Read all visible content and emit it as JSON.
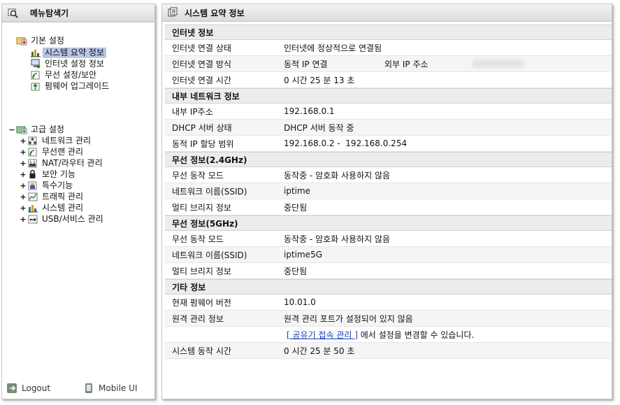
{
  "left": {
    "title": "메뉴탐색기",
    "groups": {
      "basic": {
        "label": "기본 설정",
        "items": [
          "시스템 요약 정보",
          "인터넷 설정 정보",
          "무선 설정/보안",
          "펌웨어 업그레이드"
        ]
      },
      "advanced": {
        "toggle": "−",
        "label": "고급 설정",
        "items": [
          "네트워크 관리",
          "무선랜 관리",
          "NAT/라우터 관리",
          "보안 기능",
          "특수기능",
          "트래픽 관리",
          "시스템 관리",
          "USB/서비스 관리"
        ],
        "item_toggle": "+"
      }
    },
    "bottom": {
      "logout": "Logout",
      "mobile": "Mobile UI"
    }
  },
  "right": {
    "title": "시스템 요약 정보",
    "internet": {
      "title": "인터넷 정보",
      "status_k": "인터넷 연결 상태",
      "status_v": "인터넷에 정상적으로 연결됨",
      "method_k": "인터넷 연결 방식",
      "method_v": "동적 IP 연결",
      "external_ip_k": "외부 IP 주소",
      "time_k": "인터넷 연결 시간",
      "time_v": "0 시간 25 분 13 초"
    },
    "lan": {
      "title": "내부 네트워크 정보",
      "ip_k": "내부 IP주소",
      "ip_v": "192.168.0.1",
      "dhcp_k": "DHCP 서버 상태",
      "dhcp_v": "DHCP 서버 동작 중",
      "range_k": "동적 IP 할당 범위",
      "range_v": "192.168.0.2 -  192.168.0.254"
    },
    "w24": {
      "title": "무선 정보(2.4GHz)",
      "mode_k": "무선 동작 모드",
      "mode_v": "동작중 - 암호화 사용하지 않음",
      "ssid_k": "네트워크 이름(SSID)",
      "ssid_v": "iptime",
      "bridge_k": "멀티 브리지 정보",
      "bridge_v": "중단됨"
    },
    "w5": {
      "title": "무선 정보(5GHz)",
      "mode_k": "무선 동작 모드",
      "mode_v": "동작중 - 암호화 사용하지 않음",
      "ssid_k": "네트워크 이름(SSID)",
      "ssid_v": "iptime5G",
      "bridge_k": "멀티 브리지 정보",
      "bridge_v": "중단됨"
    },
    "etc": {
      "title": "기타 정보",
      "fw_k": "현재 펌웨어 버전",
      "fw_v": "10.01.0",
      "remote_k": "원격 관리 정보",
      "remote_v": "원격 관리 포트가 설정되어 있지 않음",
      "remote_link": "[ 공유기 접속 관리 ]",
      "remote_link_tail": "에서 설정을 변경할 수 있습니다.",
      "uptime_k": "시스템 동작 시간",
      "uptime_v": "0 시간 25 분 50 초"
    }
  }
}
